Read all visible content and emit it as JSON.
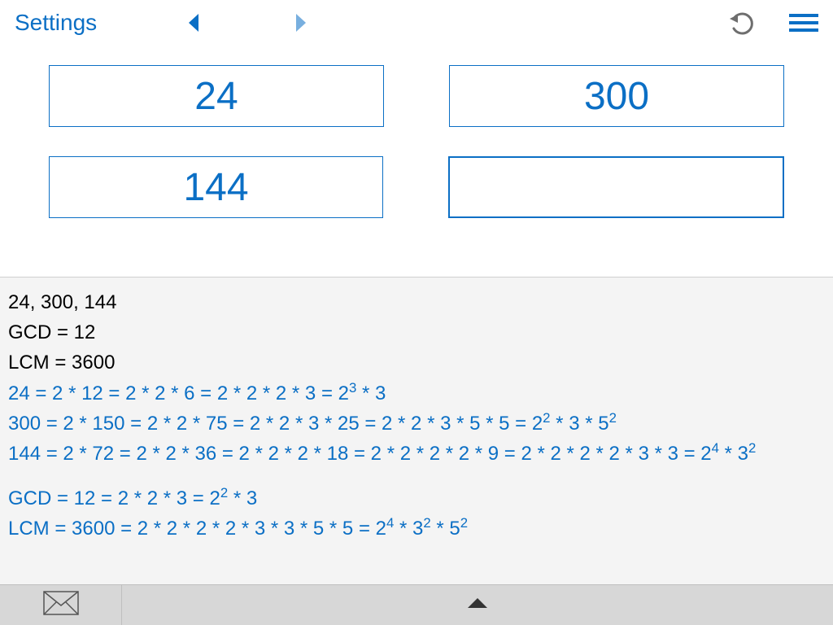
{
  "topbar": {
    "settings_label": "Settings"
  },
  "inputs": {
    "field1": "24",
    "field2": "300",
    "field3": "144",
    "field4": ""
  },
  "results": {
    "input_summary": "24, 300, 144",
    "gcd_summary": "GCD = 12",
    "lcm_summary": "LCM = 3600",
    "factorizations": [
      {
        "prefix": "24 = 2 * 12 = 2 * 2 * 6 = 2 * 2 * 2 * 3 = 2",
        "sup1": "3",
        "mid1": " * 3"
      },
      {
        "prefix": "300 = 2 * 150 = 2 * 2 * 75 = 2 * 2 * 3 * 25 = 2 * 2 * 3 * 5 * 5 = 2",
        "sup1": "2",
        "mid1": " * 3 * 5",
        "sup2": "2"
      },
      {
        "prefix": "144 = 2 * 72 = 2 * 2 * 36 = 2 * 2 * 2 * 18 = 2 * 2 * 2 * 2 * 9 = 2 * 2 * 2 * 2 * 3 * 3 = 2",
        "sup1": "4",
        "mid1": " * 3",
        "sup2": "2"
      }
    ],
    "gcd_detail": {
      "prefix": "GCD = 12 = 2 * 2 * 3 = 2",
      "sup1": "2",
      "mid1": " * 3"
    },
    "lcm_detail": {
      "prefix": "LCM = 3600 = 2 * 2 * 2 * 2 * 3 * 3 * 5 * 5 = 2",
      "sup1": "4",
      "mid1": " * 3",
      "sup2": "2",
      "mid2": " * 5",
      "sup3": "2"
    }
  }
}
